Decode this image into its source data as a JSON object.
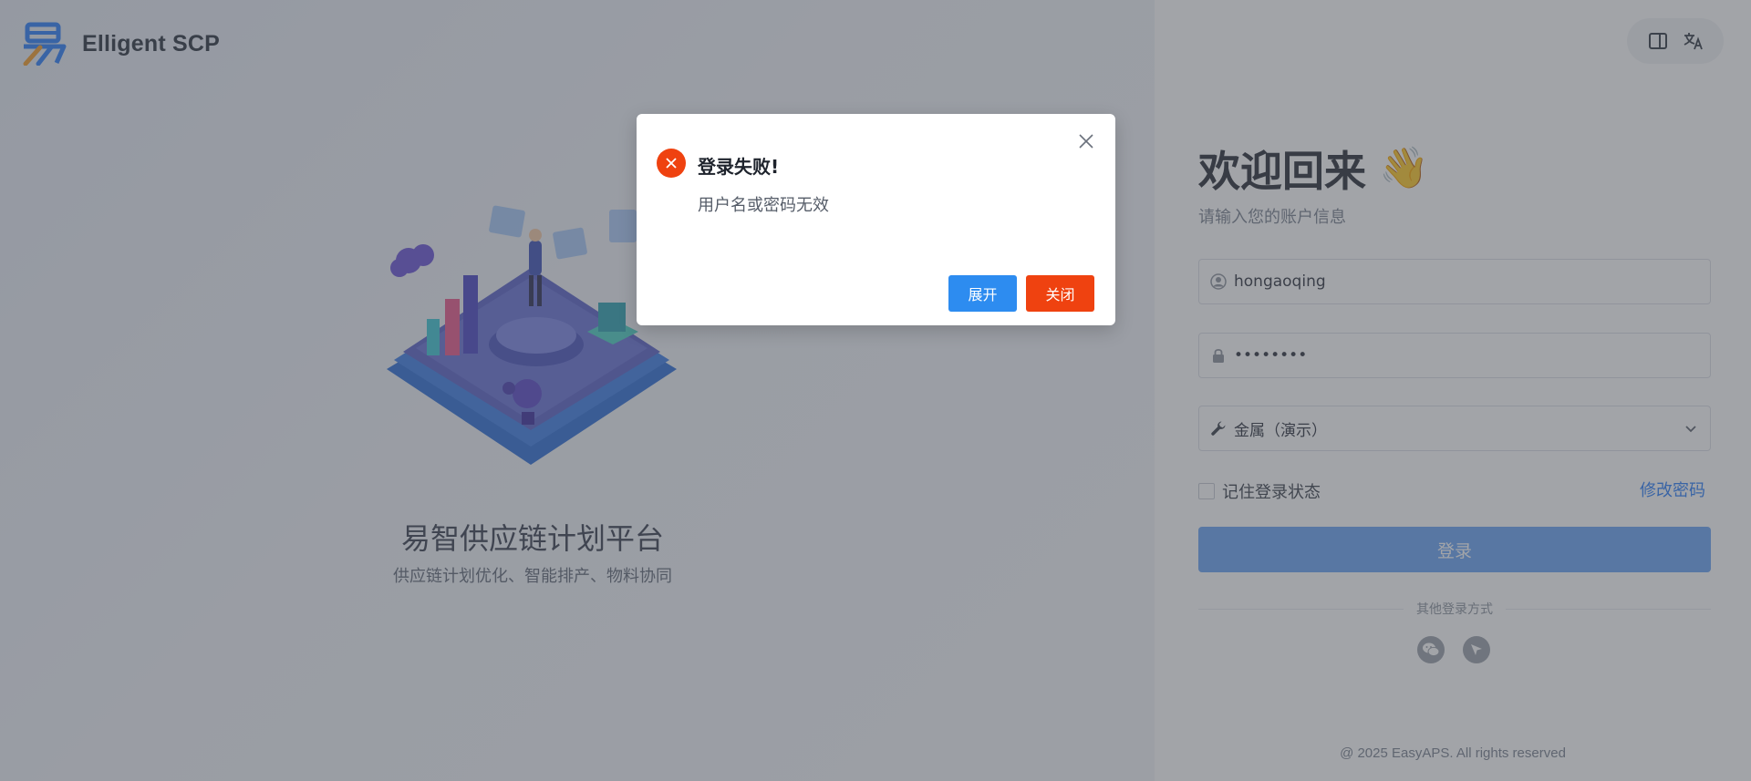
{
  "brand": {
    "name": "Elligent SCP"
  },
  "left": {
    "title": "易智供应链计划平台",
    "subtitle": "供应链计划优化、智能排产、物料协同"
  },
  "login": {
    "welcome_title": "欢迎回来",
    "welcome_emoji": "👋",
    "welcome_subtitle": "请输入您的账户信息",
    "username_value": "hongaoqing",
    "password_value": "••••••••",
    "tenant_value": "金属（演示）",
    "remember_label": "记住登录状态",
    "change_password": "修改密码",
    "login_button": "登录",
    "other_methods": "其他登录方式"
  },
  "footer": {
    "text": "@ 2025 EasyAPS. All rights reserved"
  },
  "dialog": {
    "title": "登录失败!",
    "message": "用户名或密码无效",
    "expand_button": "展开",
    "close_button": "关闭"
  },
  "colors": {
    "primary": "#2d8cf0",
    "danger": "#ef4210",
    "login_button": "#6aa4f5",
    "link": "#2d7ff9"
  },
  "icons": {
    "toolbar": [
      "sidebar-toggle-icon",
      "translate-icon"
    ],
    "social": [
      "wechat-icon",
      "navigation-icon"
    ]
  }
}
